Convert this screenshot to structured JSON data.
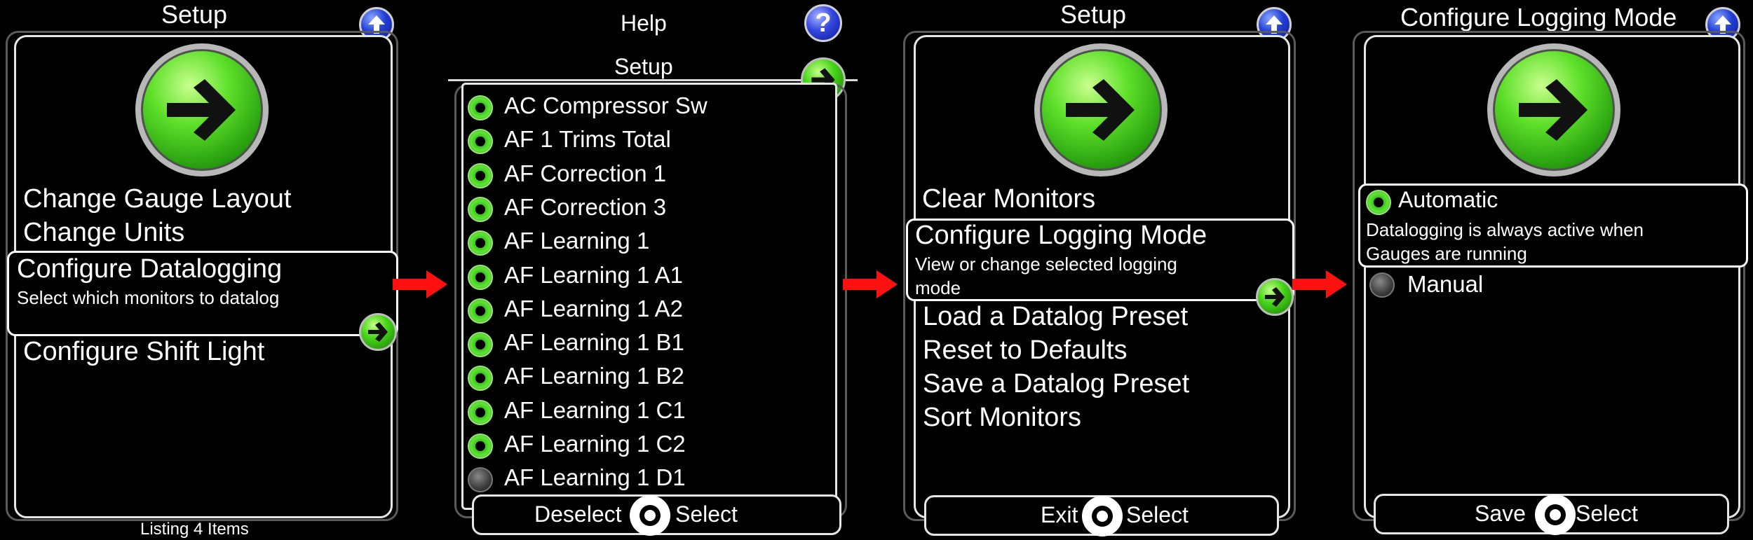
{
  "colors": {
    "accent_green": "#39c51b",
    "up_blue": "#2540d8",
    "arrow_red": "#ff1010",
    "frame": "#e6e6e6"
  },
  "panel1": {
    "title": "Setup",
    "items": [
      "Change Gauge Layout",
      "Change Units"
    ],
    "selected": {
      "title": "Configure Datalogging",
      "desc": "Select which monitors to datalog"
    },
    "after": "Configure Shift Light",
    "status": "Listing 4 Items"
  },
  "panel2": {
    "help_title": "Help",
    "help_icon": "?",
    "title": "Setup",
    "items": [
      {
        "label": "AC Compressor Sw",
        "checked": true
      },
      {
        "label": "AF 1 Trims Total",
        "checked": true
      },
      {
        "label": "AF Correction 1",
        "checked": true
      },
      {
        "label": "AF Correction 3",
        "checked": true
      },
      {
        "label": "AF Learning 1",
        "checked": true
      },
      {
        "label": "AF Learning 1 A1",
        "checked": true
      },
      {
        "label": "AF Learning 1 A2",
        "checked": true
      },
      {
        "label": "AF Learning 1 B1",
        "checked": true
      },
      {
        "label": "AF Learning 1 B2",
        "checked": true
      },
      {
        "label": "AF Learning 1 C1",
        "checked": true
      },
      {
        "label": "AF Learning 1 C2",
        "checked": true
      },
      {
        "label": "AF Learning 1 D1",
        "checked": false
      }
    ],
    "footer_left": "Deselect",
    "footer_right": "Select"
  },
  "panel3": {
    "title": "Setup",
    "item_first": "Clear Monitors",
    "selected": {
      "title": "Configure Logging Mode",
      "desc1": "View or change selected logging",
      "desc2": "mode"
    },
    "items": [
      "Load a Datalog Preset",
      "Reset to Defaults",
      "Save a Datalog Preset",
      "Sort Monitors"
    ],
    "footer_left": "Exit",
    "footer_right": "Select"
  },
  "panel4": {
    "title": "Configure Logging Mode",
    "selected": {
      "title": "Automatic",
      "desc1": "Datalogging is always active when",
      "desc2": "Gauges are running"
    },
    "other": "Manual",
    "footer_left": "Save",
    "footer_right": "Select"
  }
}
